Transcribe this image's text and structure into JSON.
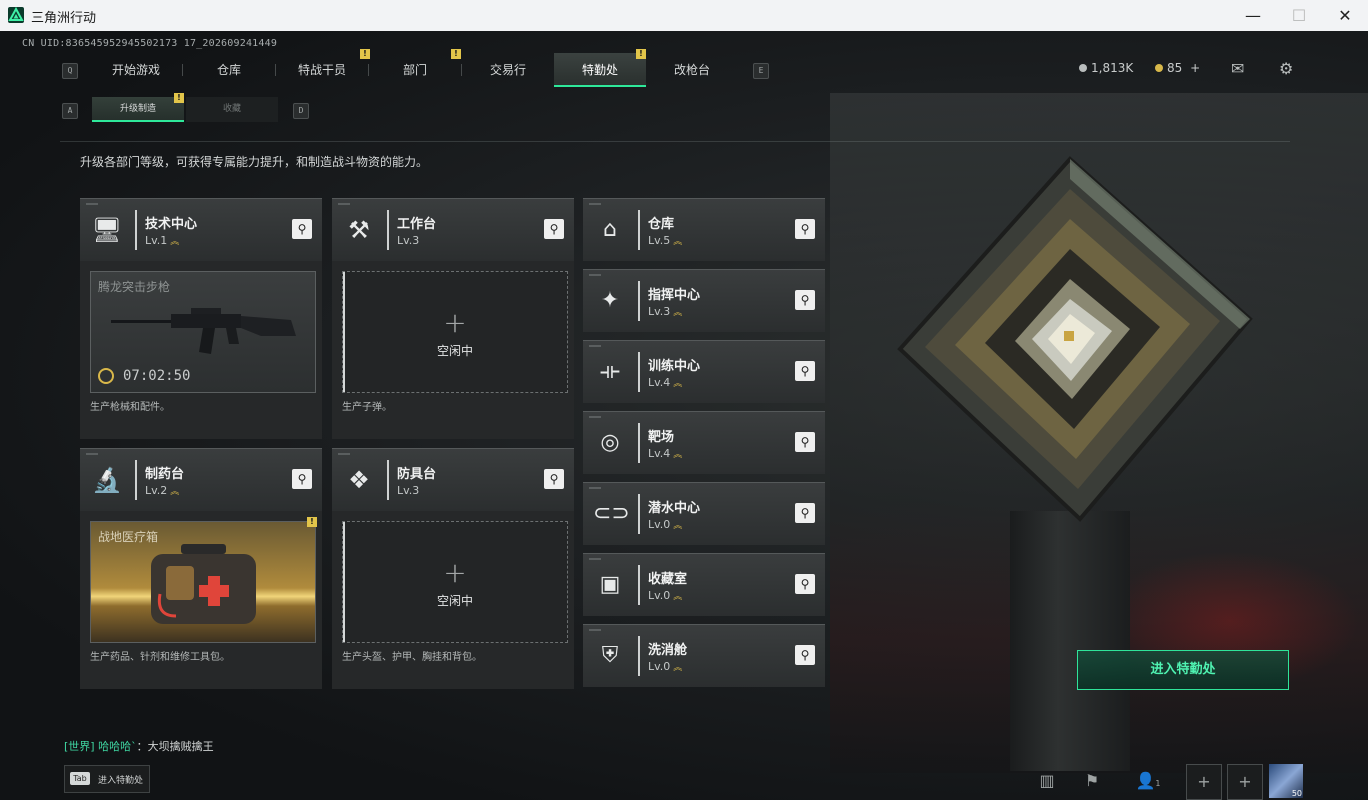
{
  "window": {
    "title": "三角洲行动",
    "minimize": "—",
    "maximize": "☐",
    "close": "✕"
  },
  "uid": "CN UID:836545952945502173 17_202609241449",
  "nav": {
    "key_left": "Q",
    "key_right": "E",
    "tabs": [
      {
        "label": "开始游戏",
        "badge": ""
      },
      {
        "label": "仓库",
        "badge": ""
      },
      {
        "label": "特战干员",
        "badge": "!"
      },
      {
        "label": "部门",
        "badge": "!"
      },
      {
        "label": "交易行",
        "badge": ""
      },
      {
        "label": "特勤处",
        "badge": "!"
      },
      {
        "label": "改枪台",
        "badge": ""
      }
    ]
  },
  "currency": {
    "money": "1,813K",
    "coins": "85",
    "plus": "+"
  },
  "subnav": {
    "key_left": "A",
    "key_right": "D",
    "tabs": [
      {
        "label": "升级制造",
        "badge": "!"
      },
      {
        "label": "收藏",
        "badge": ""
      }
    ]
  },
  "description": "升级各部门等级，可获得专属能力提升，和制造战斗物资的能力。",
  "stations": [
    {
      "name": "技术中心",
      "level": "Lv.1",
      "icon": "monitor-icon",
      "slot_title": "腾龙突击步枪",
      "timer": "07:02:50",
      "footer": "生产枪械和配件。"
    },
    {
      "name": "工作台",
      "level": "Lv.3",
      "icon": "tools-icon",
      "slot_title": "",
      "idle": "空闲中",
      "plus": "+",
      "footer": "生产子弹。"
    },
    {
      "name": "制药台",
      "level": "Lv.2",
      "icon": "microscope-icon",
      "slot_title": "战地医疗箱",
      "badge": "!",
      "footer": "生产药品、针剂和维修工具包。"
    },
    {
      "name": "防具台",
      "level": "Lv.3",
      "icon": "cubes-icon",
      "slot_title": "",
      "idle": "空闲中",
      "plus": "+",
      "footer": "生产头盔、护甲、胸挂和背包。"
    }
  ],
  "departments": [
    {
      "name": "仓库",
      "level": "Lv.5",
      "icon": "warehouse-icon"
    },
    {
      "name": "指挥中心",
      "level": "Lv.3",
      "icon": "command-icon"
    },
    {
      "name": "训练中心",
      "level": "Lv.4",
      "icon": "dumbbell-icon"
    },
    {
      "name": "靶场",
      "level": "Lv.4",
      "icon": "target-icon"
    },
    {
      "name": "潜水中心",
      "level": "Lv.0",
      "icon": "diving-mask-icon"
    },
    {
      "name": "收藏室",
      "level": "Lv.0",
      "icon": "collection-icon"
    },
    {
      "name": "洗消舱",
      "level": "Lv.0",
      "icon": "decon-icon"
    }
  ],
  "enter_button": "进入特勤处",
  "chat": {
    "channel": "[世界]",
    "user": "哈哈哈`",
    "message": "：大坝擒贼擒王"
  },
  "tab_hint": {
    "key": "Tab",
    "label": "进入特勤处"
  },
  "bottom": {
    "friends_count": "1",
    "level": "50"
  },
  "colors": {
    "accent": "#2ee89a",
    "badge": "#e2c54a",
    "level_chevron": "#d8b84a"
  }
}
